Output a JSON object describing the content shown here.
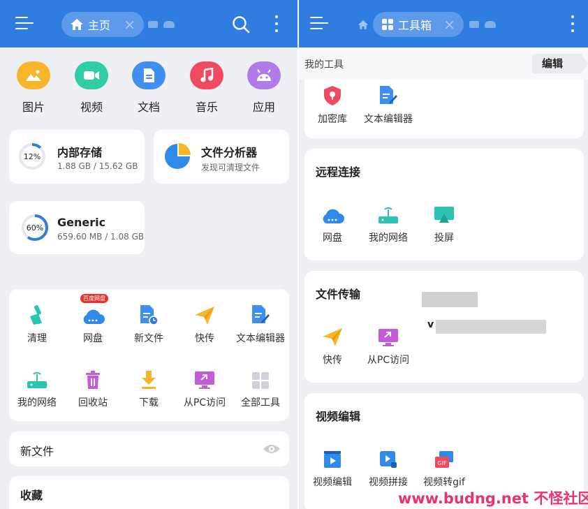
{
  "left": {
    "tab": {
      "label": "主页"
    },
    "categories": [
      {
        "label": "图片",
        "color": "#f7b52c"
      },
      {
        "label": "视频",
        "color": "#2fcca6"
      },
      {
        "label": "文档",
        "color": "#3f8ff0"
      },
      {
        "label": "音乐",
        "color": "#f04a62"
      },
      {
        "label": "应用",
        "color": "#b07be8"
      }
    ],
    "internal_storage": {
      "title": "内部存储",
      "detail": "1.88 GB / 15.62 GB",
      "percent": 12,
      "percent_label": "12%"
    },
    "analyzer": {
      "title": "文件分析器",
      "subtitle": "发现可清理文件"
    },
    "generic": {
      "title": "Generic",
      "detail": "659.60 MB / 1.08 GB",
      "percent": 60,
      "percent_label": "60%"
    },
    "tools": [
      {
        "label": "清理",
        "icon": "broom-icon"
      },
      {
        "label": "网盘",
        "icon": "cloud-disk-icon",
        "badge": "百度网盘"
      },
      {
        "label": "新文件",
        "icon": "new-file-icon"
      },
      {
        "label": "快传",
        "icon": "paper-plane-icon"
      },
      {
        "label": "文本编辑器",
        "icon": "text-editor-icon"
      },
      {
        "label": "我的网络",
        "icon": "router-icon"
      },
      {
        "label": "回收站",
        "icon": "trash-icon"
      },
      {
        "label": "下载",
        "icon": "download-icon"
      },
      {
        "label": "从PC访问",
        "icon": "pc-access-icon"
      },
      {
        "label": "全部工具",
        "icon": "grid-icon"
      }
    ],
    "new_files": {
      "title": "新文件"
    },
    "favorites": {
      "title": "收藏"
    }
  },
  "right": {
    "tab": {
      "label": "工具箱"
    },
    "my_tools": {
      "label": "我的工具",
      "edit_label": "编辑"
    },
    "top_tools": [
      {
        "label": "加密库",
        "icon": "vault-icon"
      },
      {
        "label": "文本编辑器",
        "icon": "text-editor-icon"
      }
    ],
    "remote": {
      "title": "远程连接",
      "items": [
        {
          "label": "网盘",
          "icon": "cloud-disk-icon"
        },
        {
          "label": "我的网络",
          "icon": "router-icon"
        },
        {
          "label": "投屏",
          "icon": "cast-screen-icon"
        }
      ]
    },
    "transfer": {
      "title": "文件传输",
      "items": [
        {
          "label": "快传",
          "icon": "paper-plane-icon"
        },
        {
          "label": "从PC访问",
          "icon": "pc-access-icon"
        }
      ],
      "fragment": "v"
    },
    "video": {
      "title": "视频编辑",
      "items": [
        {
          "label": "视频编辑",
          "icon": "video-edit-icon"
        },
        {
          "label": "视频拼接",
          "icon": "video-merge-icon"
        },
        {
          "label": "视频转gif",
          "icon": "gif-icon"
        }
      ]
    }
  },
  "watermark": "www.budng.net 不怪社区"
}
